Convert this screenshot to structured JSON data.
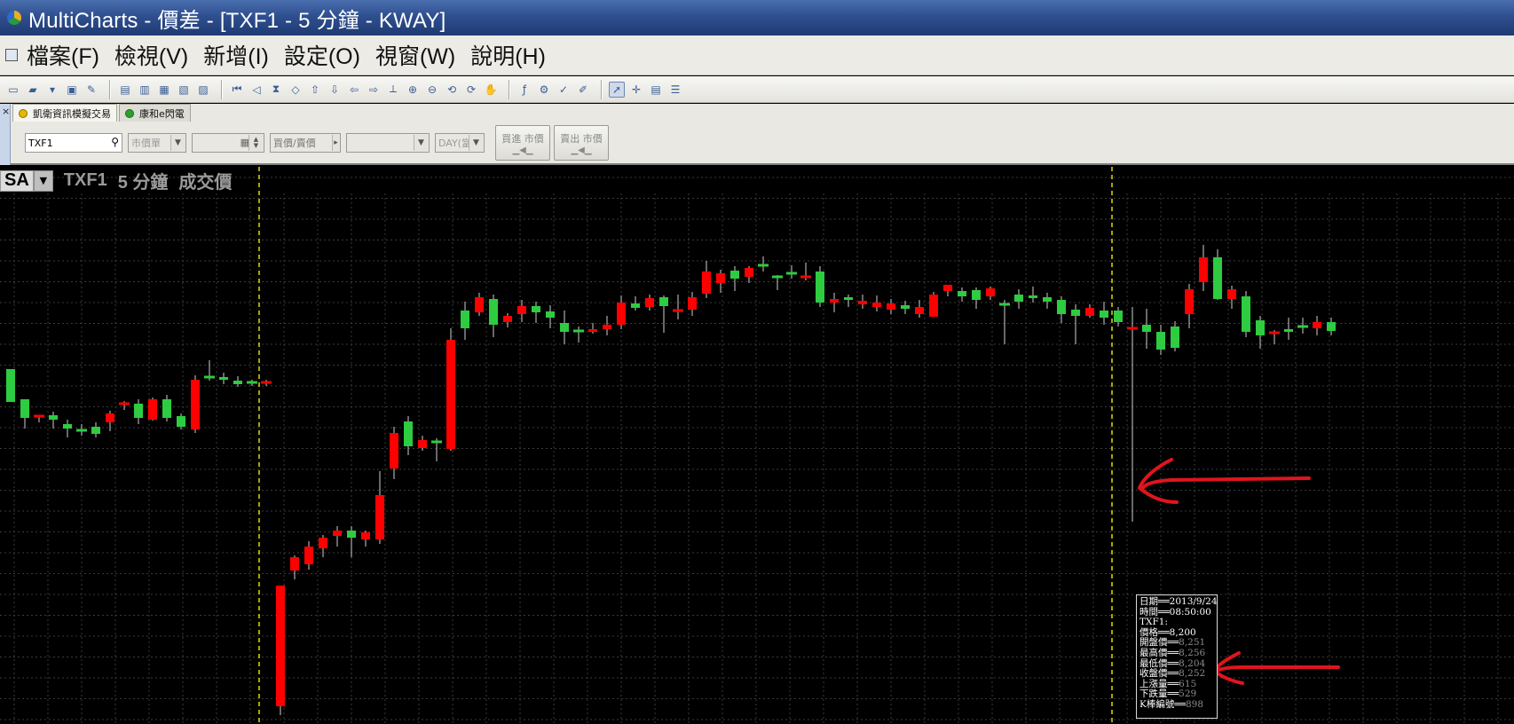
{
  "window": {
    "title": "MultiCharts - 價差 - [TXF1 - 5 分鐘 - KWAY]"
  },
  "menu": {
    "items": [
      "檔案(F)",
      "檢視(V)",
      "新增(I)",
      "設定(O)",
      "視窗(W)",
      "說明(H)"
    ]
  },
  "toolbar": {
    "icons": [
      "new-window-icon",
      "open-folder-icon",
      "dropdown-icon",
      "save-icon",
      "edit-icon",
      "chart-icon",
      "chart2-icon",
      "chart3-icon",
      "chart4-icon",
      "chart5-icon",
      "first-bar-icon",
      "scroll-left-icon",
      "hourglass-icon",
      "diamond-icon",
      "up-arrow-icon",
      "down-arrow-icon",
      "left-arrow-icon",
      "right-arrow-icon",
      "split-icon",
      "zoom-in-icon",
      "zoom-out-icon",
      "rotate-icon",
      "refresh-icon",
      "hand-icon",
      "indicator-icon",
      "strategy-icon",
      "signal-icon",
      "pencil-icon",
      "cursor-icon",
      "crosshair-icon",
      "data-window-icon",
      "settings-icon"
    ]
  },
  "orderbar": {
    "tabs": [
      {
        "label": "凱衛資訊模擬交易",
        "color": "#e6b800"
      },
      {
        "label": "康和e閃電",
        "color": "#2ca02c"
      }
    ],
    "symbol_input": "TXF1",
    "order_type": "市價單",
    "price_field": "",
    "side_select": "買價/賣價",
    "blank_select": "",
    "duration": "DAY(當",
    "buy_button": "買進 市價",
    "sell_button": "賣出 市價"
  },
  "chart": {
    "sa_label": "SA",
    "symbol": "TXF1",
    "interval": "5 分鐘",
    "field": "成交價",
    "up_color": "#ff0000",
    "down_color": "#2ecc40",
    "session_line_color": "#e6d800"
  },
  "data_window": {
    "rows": [
      {
        "label": "日期",
        "value": "2013/9/24"
      },
      {
        "label": "時間",
        "value": "08:50:00"
      },
      {
        "label": "TXF1:",
        "value": ""
      },
      {
        "label": "價格",
        "value": "8,200"
      },
      {
        "label": "開盤價",
        "value": "8,251"
      },
      {
        "label": "最高價",
        "value": "8,256"
      },
      {
        "label": "最低價",
        "value": "8,204"
      },
      {
        "label": "收盤價",
        "value": "8,252"
      },
      {
        "label": "上漲量",
        "value": "615"
      },
      {
        "label": "下跌量",
        "value": "529"
      },
      {
        "label": "K棒編號",
        "value": "898"
      }
    ]
  }
}
